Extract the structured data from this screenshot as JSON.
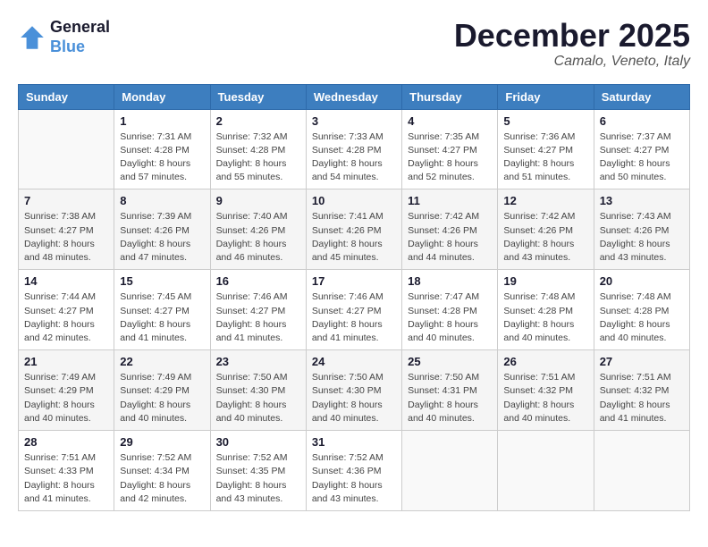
{
  "header": {
    "logo_line1": "General",
    "logo_line2": "Blue",
    "month": "December 2025",
    "location": "Camalo, Veneto, Italy"
  },
  "weekdays": [
    "Sunday",
    "Monday",
    "Tuesday",
    "Wednesday",
    "Thursday",
    "Friday",
    "Saturday"
  ],
  "weeks": [
    [
      {
        "day": "",
        "info": ""
      },
      {
        "day": "1",
        "info": "Sunrise: 7:31 AM\nSunset: 4:28 PM\nDaylight: 8 hours\nand 57 minutes."
      },
      {
        "day": "2",
        "info": "Sunrise: 7:32 AM\nSunset: 4:28 PM\nDaylight: 8 hours\nand 55 minutes."
      },
      {
        "day": "3",
        "info": "Sunrise: 7:33 AM\nSunset: 4:28 PM\nDaylight: 8 hours\nand 54 minutes."
      },
      {
        "day": "4",
        "info": "Sunrise: 7:35 AM\nSunset: 4:27 PM\nDaylight: 8 hours\nand 52 minutes."
      },
      {
        "day": "5",
        "info": "Sunrise: 7:36 AM\nSunset: 4:27 PM\nDaylight: 8 hours\nand 51 minutes."
      },
      {
        "day": "6",
        "info": "Sunrise: 7:37 AM\nSunset: 4:27 PM\nDaylight: 8 hours\nand 50 minutes."
      }
    ],
    [
      {
        "day": "7",
        "info": "Sunrise: 7:38 AM\nSunset: 4:27 PM\nDaylight: 8 hours\nand 48 minutes."
      },
      {
        "day": "8",
        "info": "Sunrise: 7:39 AM\nSunset: 4:26 PM\nDaylight: 8 hours\nand 47 minutes."
      },
      {
        "day": "9",
        "info": "Sunrise: 7:40 AM\nSunset: 4:26 PM\nDaylight: 8 hours\nand 46 minutes."
      },
      {
        "day": "10",
        "info": "Sunrise: 7:41 AM\nSunset: 4:26 PM\nDaylight: 8 hours\nand 45 minutes."
      },
      {
        "day": "11",
        "info": "Sunrise: 7:42 AM\nSunset: 4:26 PM\nDaylight: 8 hours\nand 44 minutes."
      },
      {
        "day": "12",
        "info": "Sunrise: 7:42 AM\nSunset: 4:26 PM\nDaylight: 8 hours\nand 43 minutes."
      },
      {
        "day": "13",
        "info": "Sunrise: 7:43 AM\nSunset: 4:26 PM\nDaylight: 8 hours\nand 43 minutes."
      }
    ],
    [
      {
        "day": "14",
        "info": "Sunrise: 7:44 AM\nSunset: 4:27 PM\nDaylight: 8 hours\nand 42 minutes."
      },
      {
        "day": "15",
        "info": "Sunrise: 7:45 AM\nSunset: 4:27 PM\nDaylight: 8 hours\nand 41 minutes."
      },
      {
        "day": "16",
        "info": "Sunrise: 7:46 AM\nSunset: 4:27 PM\nDaylight: 8 hours\nand 41 minutes."
      },
      {
        "day": "17",
        "info": "Sunrise: 7:46 AM\nSunset: 4:27 PM\nDaylight: 8 hours\nand 41 minutes."
      },
      {
        "day": "18",
        "info": "Sunrise: 7:47 AM\nSunset: 4:28 PM\nDaylight: 8 hours\nand 40 minutes."
      },
      {
        "day": "19",
        "info": "Sunrise: 7:48 AM\nSunset: 4:28 PM\nDaylight: 8 hours\nand 40 minutes."
      },
      {
        "day": "20",
        "info": "Sunrise: 7:48 AM\nSunset: 4:28 PM\nDaylight: 8 hours\nand 40 minutes."
      }
    ],
    [
      {
        "day": "21",
        "info": "Sunrise: 7:49 AM\nSunset: 4:29 PM\nDaylight: 8 hours\nand 40 minutes."
      },
      {
        "day": "22",
        "info": "Sunrise: 7:49 AM\nSunset: 4:29 PM\nDaylight: 8 hours\nand 40 minutes."
      },
      {
        "day": "23",
        "info": "Sunrise: 7:50 AM\nSunset: 4:30 PM\nDaylight: 8 hours\nand 40 minutes."
      },
      {
        "day": "24",
        "info": "Sunrise: 7:50 AM\nSunset: 4:30 PM\nDaylight: 8 hours\nand 40 minutes."
      },
      {
        "day": "25",
        "info": "Sunrise: 7:50 AM\nSunset: 4:31 PM\nDaylight: 8 hours\nand 40 minutes."
      },
      {
        "day": "26",
        "info": "Sunrise: 7:51 AM\nSunset: 4:32 PM\nDaylight: 8 hours\nand 40 minutes."
      },
      {
        "day": "27",
        "info": "Sunrise: 7:51 AM\nSunset: 4:32 PM\nDaylight: 8 hours\nand 41 minutes."
      }
    ],
    [
      {
        "day": "28",
        "info": "Sunrise: 7:51 AM\nSunset: 4:33 PM\nDaylight: 8 hours\nand 41 minutes."
      },
      {
        "day": "29",
        "info": "Sunrise: 7:52 AM\nSunset: 4:34 PM\nDaylight: 8 hours\nand 42 minutes."
      },
      {
        "day": "30",
        "info": "Sunrise: 7:52 AM\nSunset: 4:35 PM\nDaylight: 8 hours\nand 43 minutes."
      },
      {
        "day": "31",
        "info": "Sunrise: 7:52 AM\nSunset: 4:36 PM\nDaylight: 8 hours\nand 43 minutes."
      },
      {
        "day": "",
        "info": ""
      },
      {
        "day": "",
        "info": ""
      },
      {
        "day": "",
        "info": ""
      }
    ]
  ]
}
